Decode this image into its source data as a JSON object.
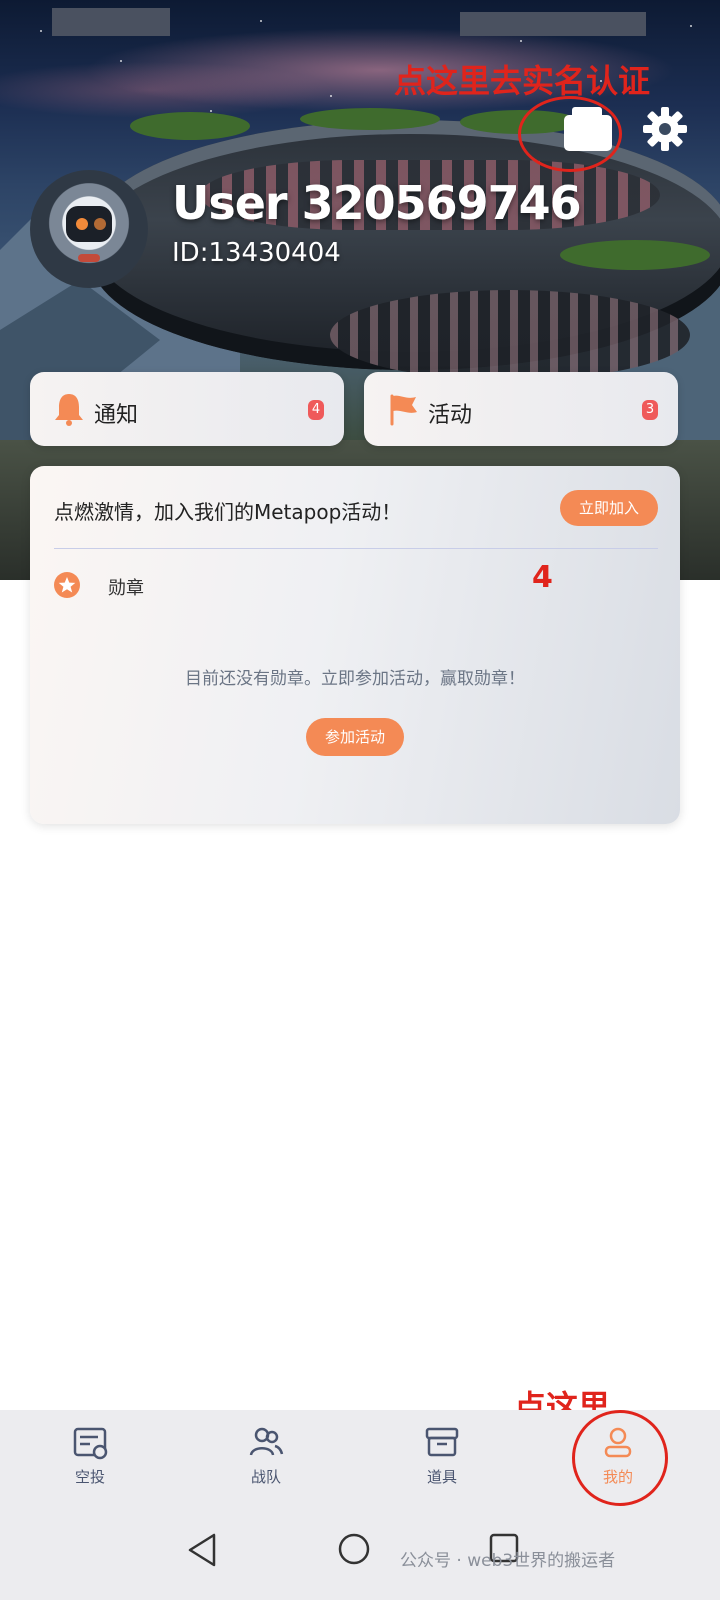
{
  "profile": {
    "username": "User 320569746",
    "id_label": "ID:13430404"
  },
  "quick_links": [
    {
      "label": "通知",
      "badge": "4",
      "icon": "bell-icon"
    },
    {
      "label": "活动",
      "badge": "3",
      "icon": "flag-icon"
    }
  ],
  "promo": {
    "text": "点燃激情，加入我们的Metapop活动！",
    "button": "立即加入"
  },
  "medals": {
    "label": "勋章",
    "empty_text": "目前还没有勋章。立即参加活动，赢取勋章！",
    "button": "参加活动"
  },
  "annotations": {
    "top": "点这里去实名认证",
    "number": "4",
    "bottom": "点这里"
  },
  "bottom_nav": [
    {
      "label": "空投",
      "icon": "airdrop-icon",
      "active": false
    },
    {
      "label": "战队",
      "icon": "team-icon",
      "active": false
    },
    {
      "label": "道具",
      "icon": "items-icon",
      "active": false
    },
    {
      "label": "我的",
      "icon": "profile-icon",
      "active": true
    }
  ],
  "watermark": "公众号 · web3世界的搬运者",
  "colors": {
    "accent": "#f48a55",
    "badge": "#ef5a5a",
    "annotation": "#e0241c",
    "nav_text": "#4a5570"
  }
}
